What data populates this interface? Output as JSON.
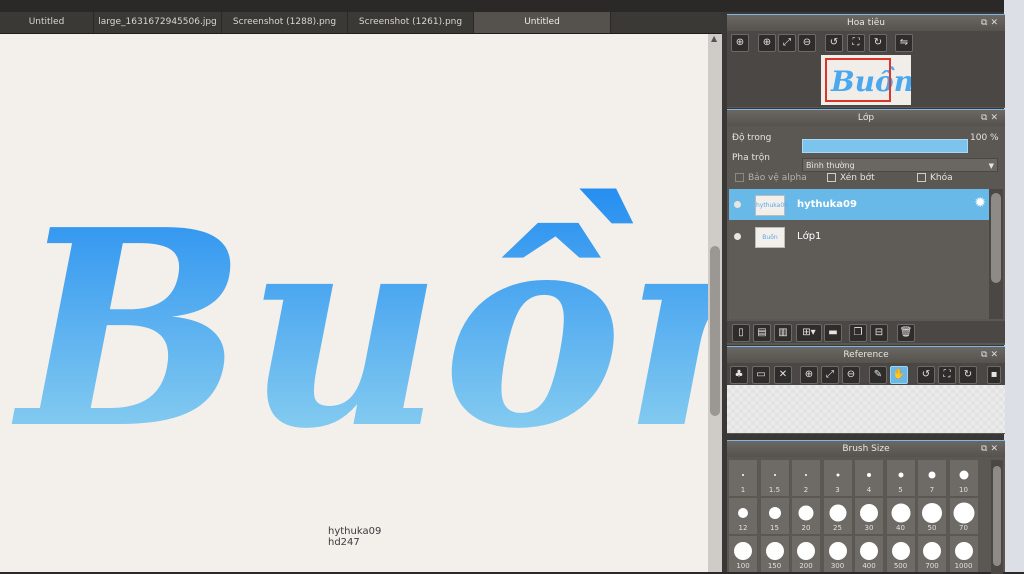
{
  "tabs": [
    "Untitled",
    "large_1631672945506.jpg",
    "Screenshot (1288).png",
    "Screenshot (1261).png",
    "Untitled"
  ],
  "active_tab_index": 4,
  "canvas": {
    "artwork_text": "Buồn",
    "caption_line1": "hythuka09",
    "caption_line2": "hd247",
    "gradient_top": "#1f8af0",
    "gradient_bottom": "#9ad9f0"
  },
  "navigator": {
    "title": "Hoa tiêu",
    "thumb_text": "Buồn"
  },
  "layers_panel": {
    "title": "Lớp",
    "opacity_label": "Độ trong",
    "opacity_value": "100 %",
    "opacity_fraction": 1.0,
    "blend_label": "Pha trộn",
    "blend_value": "Bình thường",
    "protect_alpha_label": "Bảo vệ alpha",
    "clip_label": "Xén bớt",
    "lock_label": "Khóa",
    "layers": [
      {
        "name": "hythuka09",
        "selected": true,
        "thumb": "hythuka09"
      },
      {
        "name": "Lớp1",
        "selected": false,
        "thumb": "Buồn"
      }
    ]
  },
  "reference_panel": {
    "title": "Reference"
  },
  "brush_panel": {
    "title": "Brush Size",
    "sizes": [
      "1",
      "1.5",
      "2",
      "3",
      "4",
      "5",
      "7",
      "10",
      "12",
      "15",
      "20",
      "25",
      "30",
      "40",
      "50",
      "70",
      "100",
      "150",
      "200",
      "300",
      "400",
      "500",
      "700",
      "1000"
    ]
  },
  "icons": {
    "nav_toolbar": [
      "zoom-fit-icon",
      "zoom-in-icon",
      "fit-window-icon",
      "zoom-out-icon",
      "rotate-left-icon",
      "fullscreen-icon",
      "rotate-right-icon",
      "flip-icon"
    ],
    "layer_toolbar": [
      "new-layer-icon",
      "new-layer-alt-icon",
      "new-layer-copy-icon",
      "add-menu-icon",
      "folder-icon",
      "duplicate-icon",
      "merge-icon",
      "trash-icon"
    ],
    "reference_toolbar": [
      "tree-icon",
      "open-folder-icon",
      "close-icon",
      "zoom-in-icon",
      "fit-window-icon",
      "zoom-out-icon",
      "eyedropper-icon",
      "hand-icon",
      "rotate-left-icon",
      "fullscreen-icon",
      "rotate-right-icon"
    ]
  },
  "accent_color": "#68b9e8"
}
